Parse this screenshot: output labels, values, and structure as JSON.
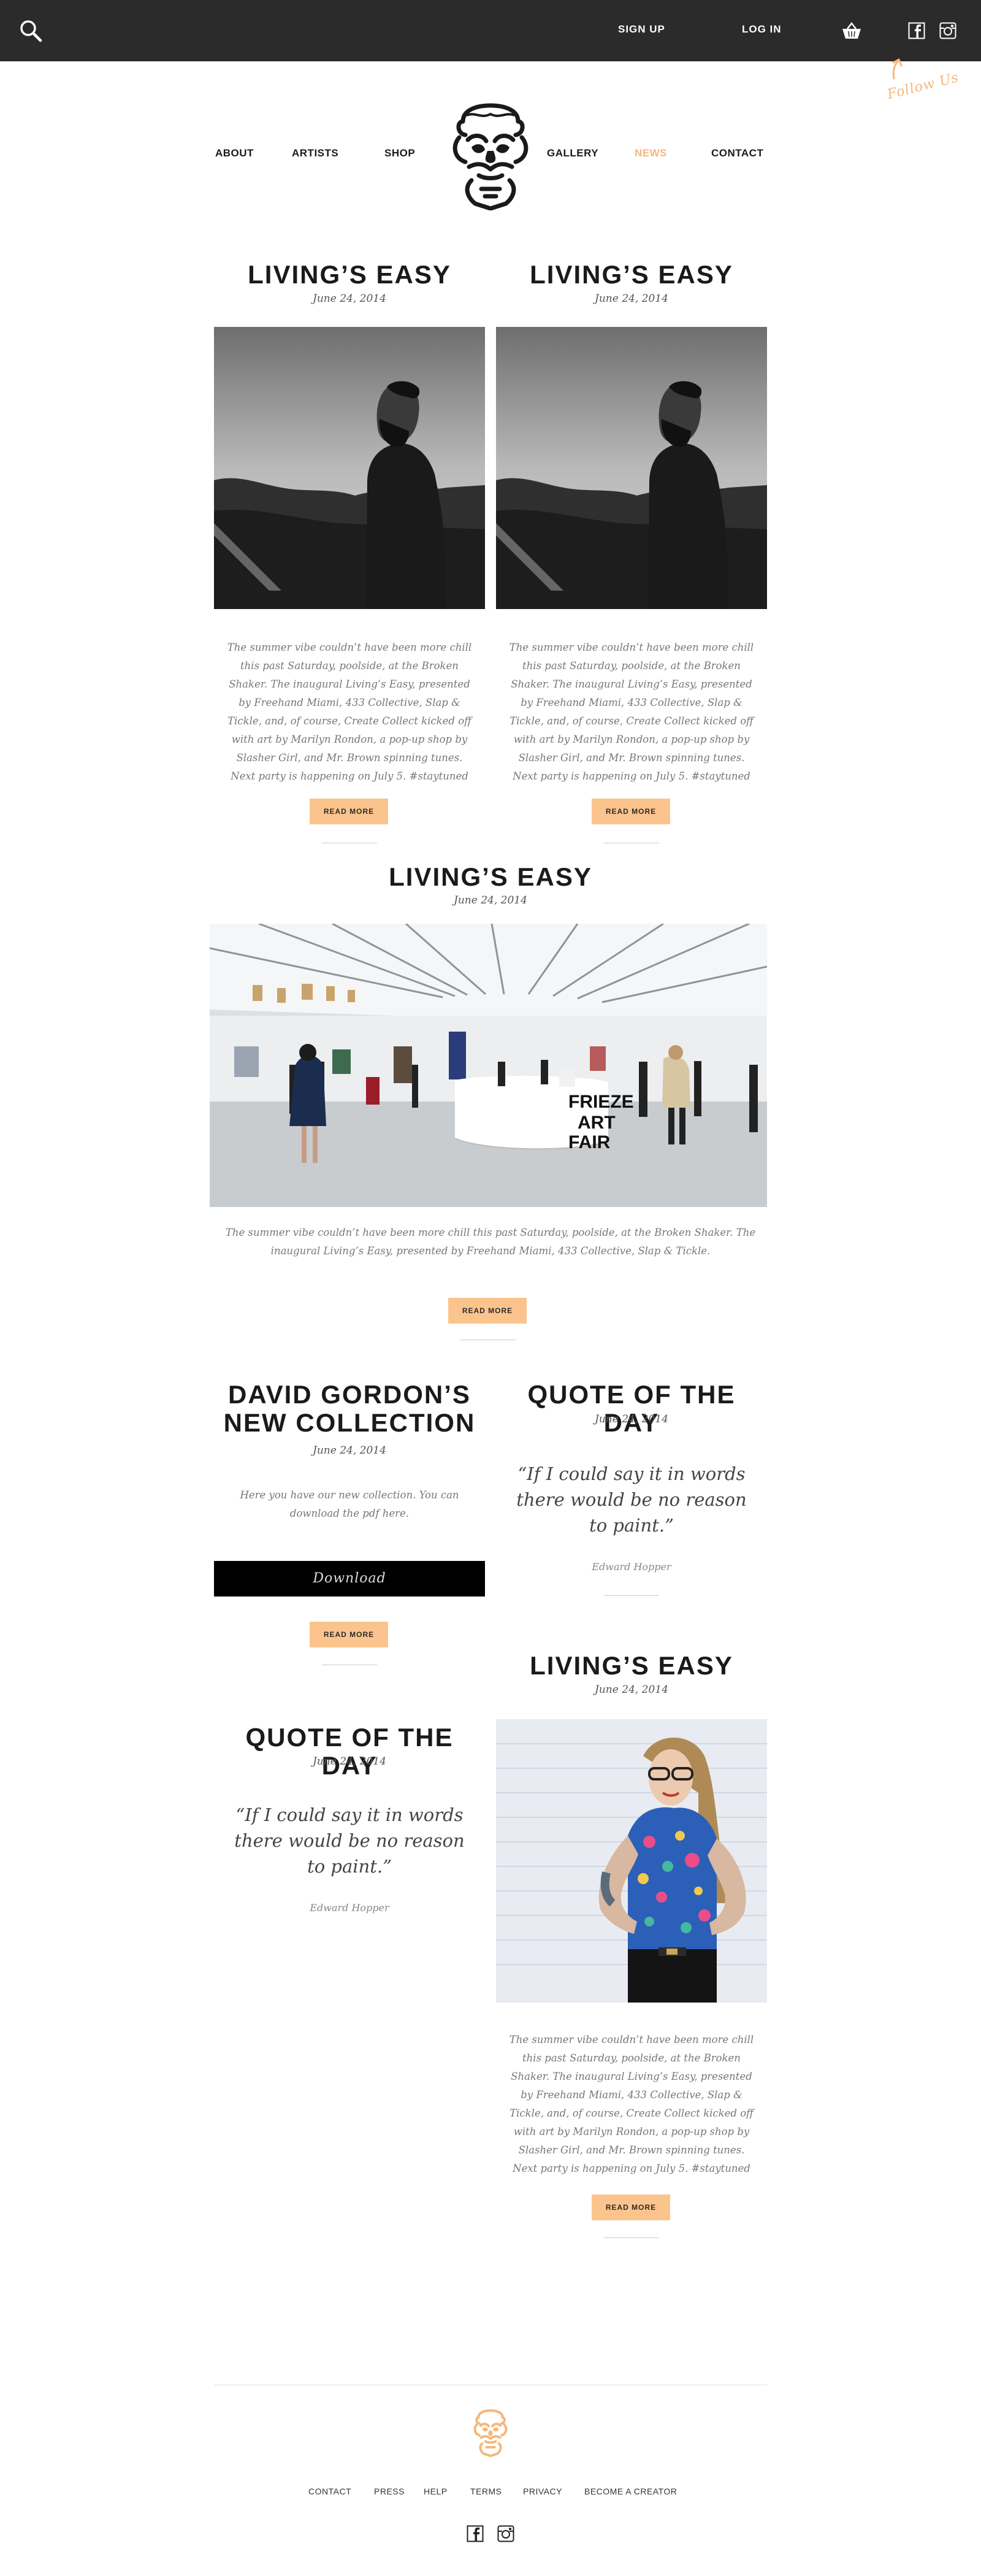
{
  "header": {
    "signup_label": "SIGN UP",
    "login_label": "LOG IN",
    "follow_us": "Follow Us"
  },
  "nav": {
    "about": "ABOUT",
    "artists": "ARTISTS",
    "shop": "SHOP",
    "gallery": "GALLERY",
    "news": "NEWS",
    "contact": "CONTACT"
  },
  "colors": {
    "topbar": "#2b2b2b",
    "accent": "#fcc48d",
    "active_nav": "#f5b77a"
  },
  "articles": {
    "a1": {
      "title": "LIVING’S EASY",
      "date": "June 24, 2014",
      "body": "The summer vibe couldn’t have been more chill this past Saturday, poolside, at the Broken Shaker. The inaugural Living’s Easy, presented by Freehand Miami, 433 Collective, Slap & Tickle, and, of course, Create Collect kicked off with art by Marilyn Rondon, a pop-up shop by Slasher Girl, and Mr. Brown spinning tunes. Next party is happening on July 5. #staytuned",
      "button": "READ MORE"
    },
    "a2": {
      "title": "LIVING’S EASY",
      "date": "June 24, 2014",
      "body": "The summer vibe couldn’t have been more chill this past Saturday, poolside, at the Broken Shaker. The inaugural Living’s Easy, presented by Freehand Miami, 433 Collective, Slap & Tickle, and, of course, Create Collect kicked off with art by Marilyn Rondon, a pop-up shop by Slasher Girl, and Mr. Brown spinning tunes. Next party is happening on July 5. #staytuned",
      "button": "READ MORE"
    },
    "a3": {
      "title": "LIVING’S EASY",
      "date": "June 24, 2014",
      "body": "The summer vibe couldn’t have been more chill this past Saturday, poolside, at the Broken Shaker. The inaugural Living’s Easy, presented by Freehand Miami, 433 Collective, Slap & Tickle.",
      "button": "READ MORE",
      "sign_text": "FRIEZE ART FAIR"
    },
    "a4": {
      "title": "DAVID GORDON’S NEW COLLECTION",
      "date": "June 24, 2014",
      "body": "Here you have our new collection. You can download the pdf here.",
      "download": "Download",
      "button": "READ MORE"
    },
    "q1": {
      "title": "QUOTE OF THE DAY",
      "date": "June 24, 2014",
      "quote": "“If I could say it in words there would be no reason to paint.”",
      "author": "Edward Hopper"
    },
    "a5": {
      "title": "LIVING’S EASY",
      "date": "June 24, 2014",
      "body": "The summer vibe couldn’t have been more chill this past Saturday, poolside, at the Broken Shaker. The inaugural Living’s Easy, presented by Freehand Miami, 433 Collective, Slap & Tickle, and, of course, Create Collect kicked off with art by Marilyn Rondon, a pop-up shop by Slasher Girl, and Mr. Brown spinning tunes. Next party is happening on July 5. #staytuned",
      "button": "READ MORE"
    },
    "q2": {
      "title": "QUOTE OF THE DAY",
      "date": "June 24, 2014",
      "quote": "“If I could say it in words there would be no reason to paint.”",
      "author": "Edward Hopper"
    }
  },
  "footer": {
    "links": [
      "CONTACT",
      "PRESS",
      "HELP",
      "TERMS",
      "PRIVACY",
      "BECOME A CREATOR"
    ]
  }
}
